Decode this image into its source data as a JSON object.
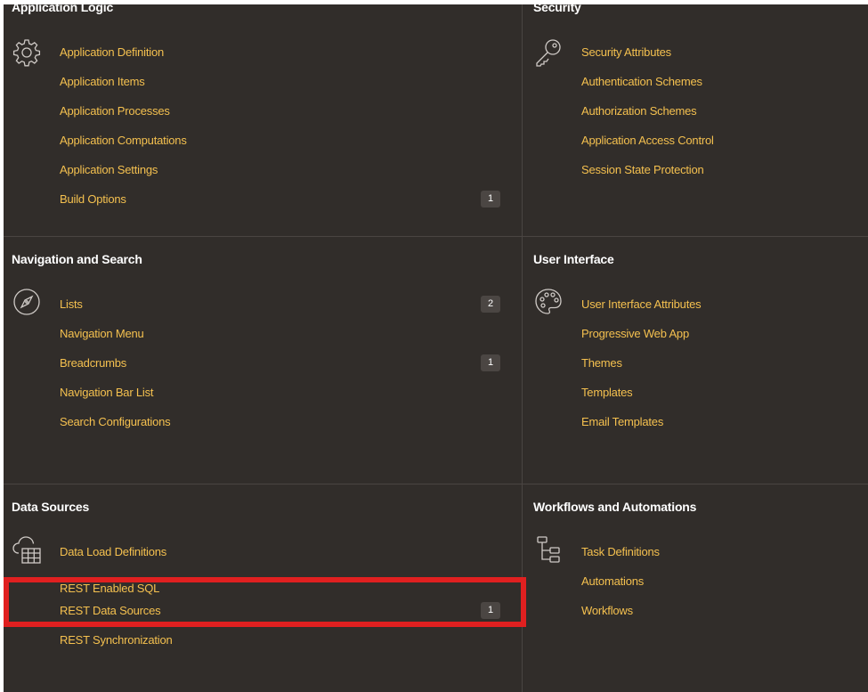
{
  "colors": {
    "background": "#312d2a",
    "link": "#f4c04f",
    "title": "#ffffff",
    "badge": "#4b4643",
    "highlight": "#e02020"
  },
  "panels": {
    "application_logic": {
      "title": "Application Logic",
      "icon": "gear-icon",
      "links": [
        {
          "label": "Application Definition"
        },
        {
          "label": "Application Items"
        },
        {
          "label": "Application Processes"
        },
        {
          "label": "Application Computations"
        },
        {
          "label": "Application Settings"
        },
        {
          "label": "Build Options",
          "badge": "1"
        }
      ]
    },
    "security": {
      "title": "Security",
      "icon": "key-icon",
      "links": [
        {
          "label": "Security Attributes"
        },
        {
          "label": "Authentication Schemes"
        },
        {
          "label": "Authorization Schemes"
        },
        {
          "label": "Application Access Control"
        },
        {
          "label": "Session State Protection"
        }
      ]
    },
    "navigation_search": {
      "title": "Navigation and Search",
      "icon": "compass-icon",
      "links": [
        {
          "label": "Lists",
          "badge": "2"
        },
        {
          "label": "Navigation Menu"
        },
        {
          "label": "Breadcrumbs",
          "badge": "1"
        },
        {
          "label": "Navigation Bar List"
        },
        {
          "label": "Search Configurations"
        }
      ]
    },
    "user_interface": {
      "title": "User Interface",
      "icon": "palette-icon",
      "links": [
        {
          "label": "User Interface Attributes"
        },
        {
          "label": "Progressive Web App"
        },
        {
          "label": "Themes"
        },
        {
          "label": "Templates"
        },
        {
          "label": "Email Templates"
        }
      ]
    },
    "data_sources": {
      "title": "Data Sources",
      "icon": "cloud-table-icon",
      "links": [
        {
          "label": "Data Load Definitions"
        },
        {
          "label": "REST Enabled SQL"
        },
        {
          "label": "REST Data Sources",
          "badge": "1"
        },
        {
          "label": "REST Synchronization"
        }
      ]
    },
    "workflows_automations": {
      "title": "Workflows and Automations",
      "icon": "hierarchy-icon",
      "links": [
        {
          "label": "Task Definitions"
        },
        {
          "label": "Automations"
        },
        {
          "label": "Workflows"
        }
      ]
    }
  }
}
